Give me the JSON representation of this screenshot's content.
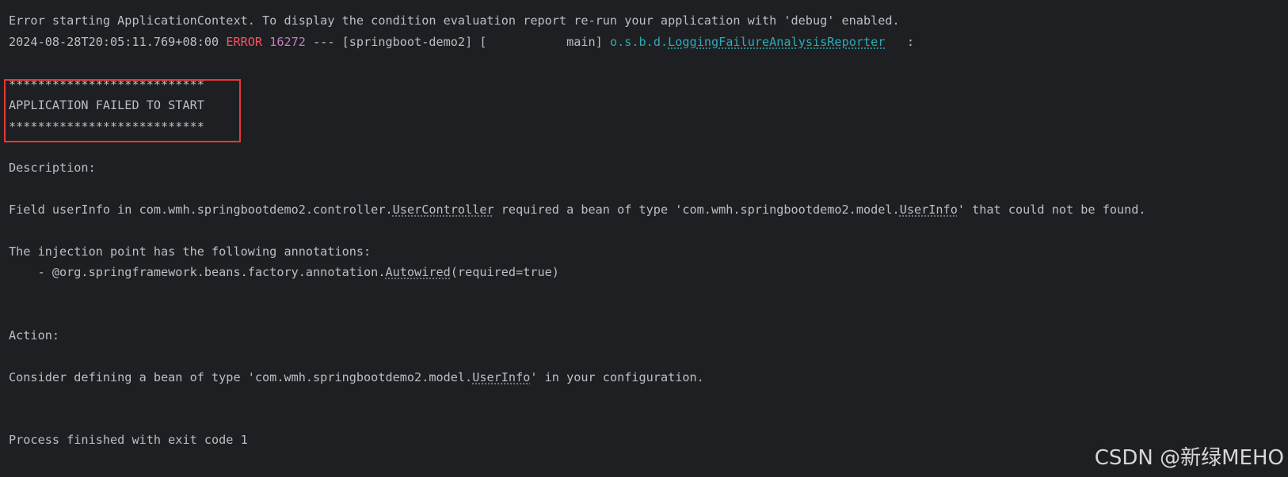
{
  "colors": {
    "background": "#1e1f22",
    "text": "#bcbec4",
    "error_level": "#f75464",
    "pid": "#c77dbb",
    "logger": "#2aacb8",
    "highlight_box": "#e53935"
  },
  "console": {
    "line1": "Error starting ApplicationContext. To display the condition evaluation report re-run your application with 'debug' enabled.",
    "log_header": {
      "timestamp": "2024-08-28T20:05:11.769+08:00",
      "level": "ERROR",
      "pid": "16272",
      "separator": " --- ",
      "app": "[springboot-demo2]",
      "thread": " [           main] ",
      "logger_package": "o.s.b.d.",
      "logger_class": "LoggingFailureAnalysisReporter",
      "tail": "   :"
    },
    "banner_top": "***************************",
    "banner_title": "APPLICATION FAILED TO START",
    "banner_bottom": "***************************",
    "description_heading": "Description:",
    "field_line": {
      "prefix": "Field userInfo in com.wmh.springbootdemo2.controller.",
      "controller_class": "UserController",
      "middle": " required a bean of type 'com.wmh.springbootdemo2.model.",
      "bean_class": "UserInfo",
      "suffix": "' that could not be found."
    },
    "injection_heading": "The injection point has the following annotations:",
    "annotation_line": {
      "prefix": "    - @org.springframework.beans.factory.annotation.",
      "annotation_class": "Autowired",
      "suffix": "(required=true)"
    },
    "action_heading": "Action:",
    "consider_line": {
      "prefix": "Consider defining a bean of type 'com.wmh.springbootdemo2.model.",
      "bean_class": "UserInfo",
      "suffix": "' in your configuration."
    },
    "exit_line": "Process finished with exit code 1"
  },
  "watermark": "CSDN @新绿MEHO"
}
